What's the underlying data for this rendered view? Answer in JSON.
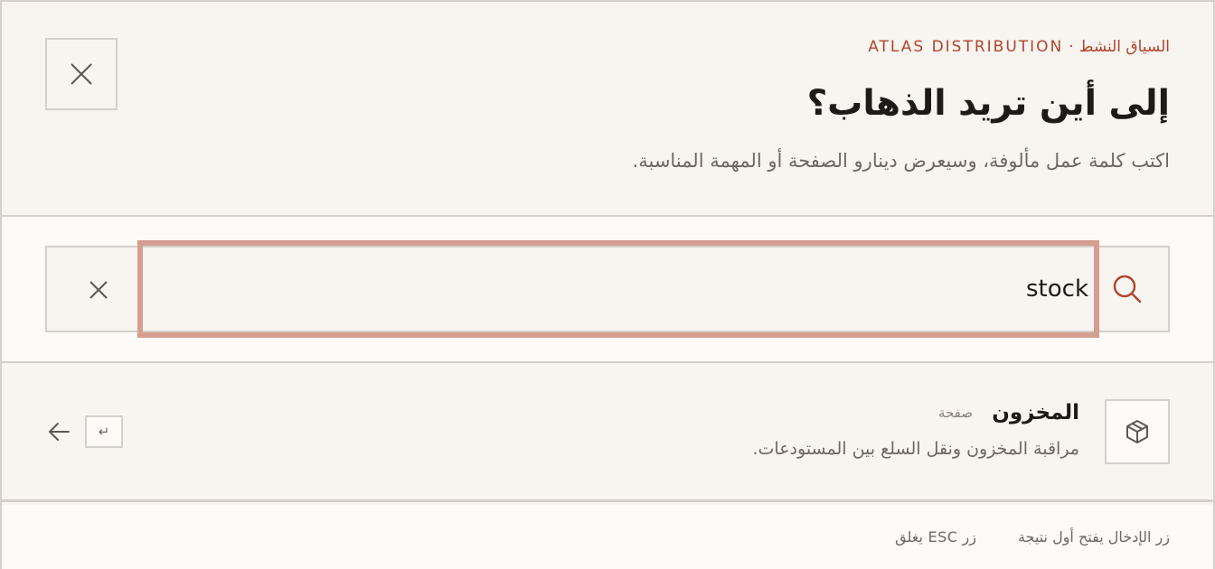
{
  "header": {
    "context_label": "السياق النشط",
    "separator": "·",
    "context_brand": "ATLAS DISTRIBUTION",
    "title": "إلى أين تريد الذهاب؟",
    "subtitle": "اكتب كلمة عمل مألوفة، وسيعرض دينارو الصفحة أو المهمة المناسبة.",
    "close_icon": "close-icon"
  },
  "search": {
    "value": "stock",
    "placeholder": "",
    "search_icon": "search-icon",
    "clear_icon": "clear-icon"
  },
  "results": [
    {
      "icon": "package-icon",
      "title": "المخزون",
      "type": "صفحة",
      "description": "مراقبة المخزون ونقل السلع بين المستودعات.",
      "enter_key": "↵",
      "arrow_icon": "arrow-left-icon"
    }
  ],
  "footer": {
    "hint_enter": "زر الإدخال يفتح أول نتيجة",
    "hint_esc": "زر ESC يغلق"
  },
  "colors": {
    "accent": "#b2442c",
    "focus_ring": "#d49e90",
    "border": "#d6cfca",
    "panel": "#f8f4f0",
    "surface": "#fdfaf8"
  }
}
